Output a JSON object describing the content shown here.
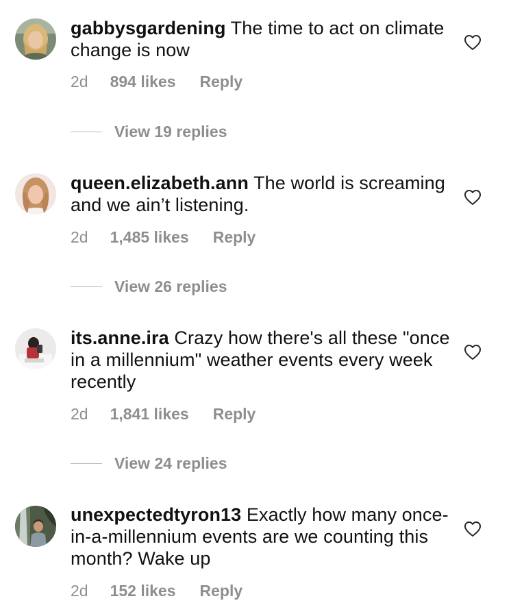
{
  "comments": [
    {
      "username": "gabbysgardening",
      "text": "The time to act on climate change is now",
      "time": "2d",
      "likes": "894 likes",
      "reply_label": "Reply",
      "view_replies": "View 19 replies",
      "avatar": "blonde-woman-avatar"
    },
    {
      "username": "queen.elizabeth.ann",
      "text": "The world is screaming and we ain’t listening.",
      "time": "2d",
      "likes": "1,485 likes",
      "reply_label": "Reply",
      "view_replies": "View 26 replies",
      "avatar": "woman-selfie-avatar"
    },
    {
      "username": "its.anne.ira",
      "text": "Crazy how there's all these \"once in a millennium\" weather events every week recently",
      "time": "2d",
      "likes": "1,841 likes",
      "reply_label": "Reply",
      "view_replies": "View 24 replies",
      "avatar": "mirror-selfie-avatar"
    },
    {
      "username": "unexpectedtyron13",
      "text": "Exactly how many once-in-a-millennium events are we counting this month? Wake up",
      "time": "2d",
      "likes": "152 likes",
      "reply_label": "Reply",
      "avatar": "waterfall-man-avatar"
    }
  ],
  "colors": {
    "primary_text": "#111111",
    "secondary_text": "#8e8e8e",
    "divider": "#b8b8b8",
    "background": "#ffffff"
  },
  "icons": {
    "like": "heart-outline-icon"
  }
}
